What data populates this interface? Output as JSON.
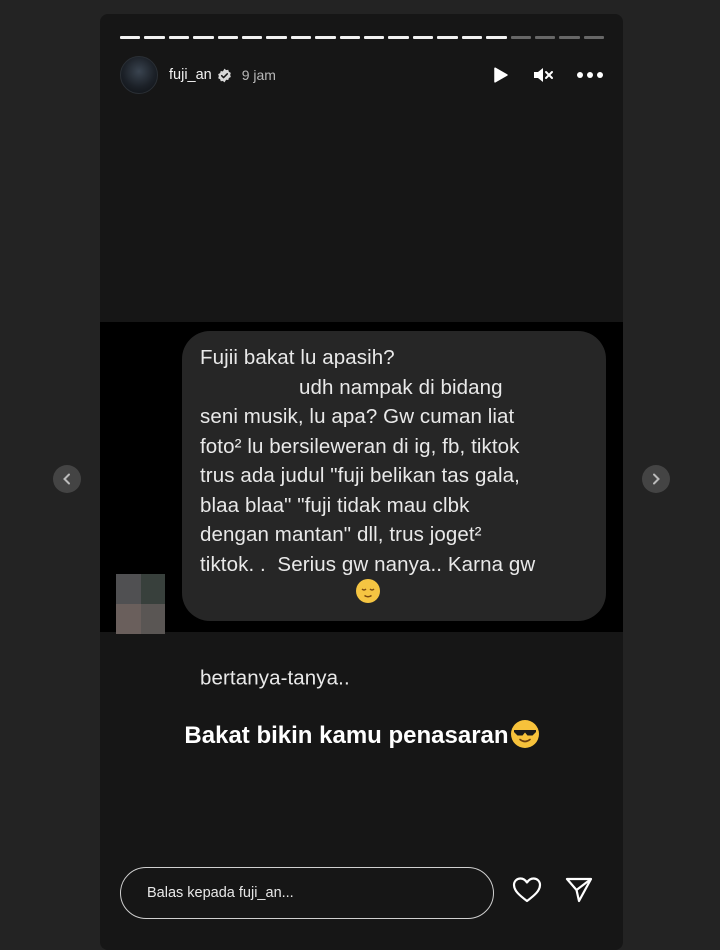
{
  "story": {
    "progress": {
      "total_segments": 20,
      "completed_segments": 16
    },
    "header": {
      "username": "fuji_an",
      "time": "9 jam",
      "icons": [
        "play-icon",
        "muted-speaker-icon",
        "more-options-icon"
      ]
    },
    "message": {
      "text": "Fujii bakat lu apasih?       \n          udh nampak di bidang\nseni musik, lu apa? Gw cuman liat\nfoto² lu bersileweran di ig, fb, tiktok\ntrus ada judul \"fuji belikan tas gala,\nblaa blaa\" \"fuji tidak mau clbk\ndengan mantan\" dll, trus joget²\ntiktok. .  Serius gw nanya.. Karna gw\nbertanya-tanya.. ",
      "emoji": "relieved-face-emoji"
    },
    "caption": {
      "text": "Bakat bikin kamu penasaran",
      "emoji": "smiling-face-with-sunglasses-emoji"
    },
    "reply": {
      "placeholder": "Balas kepada fuji_an..."
    },
    "colors": {
      "background": "#232323",
      "story_bg": "#161616",
      "bubble": "#262626"
    }
  }
}
